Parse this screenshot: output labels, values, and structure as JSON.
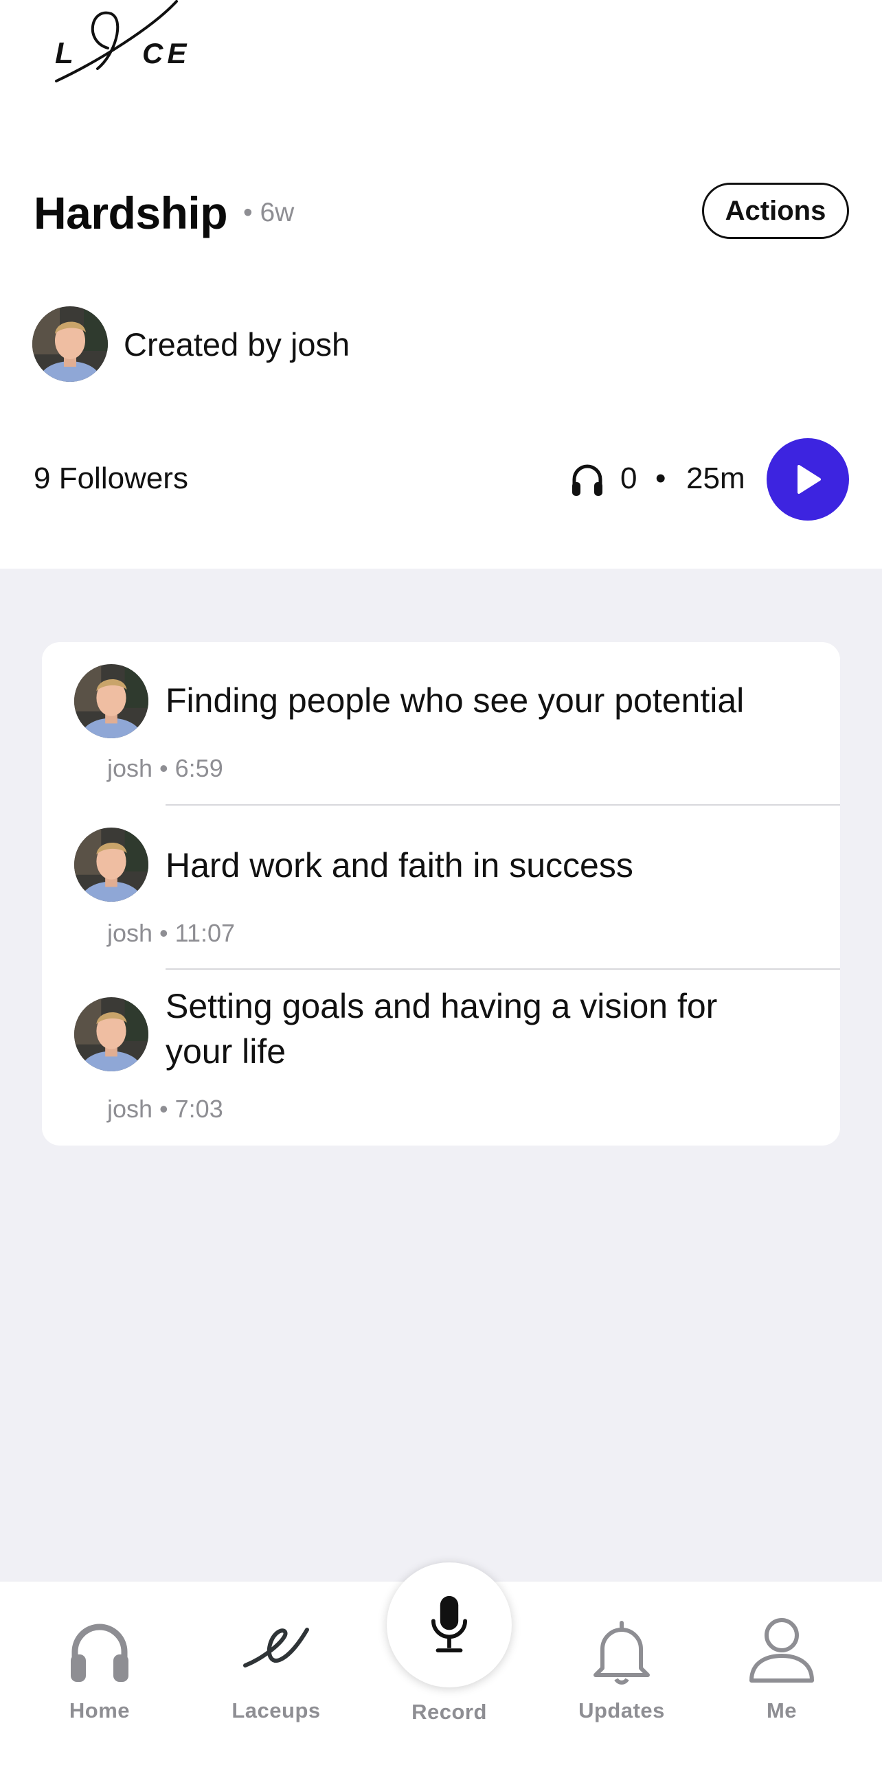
{
  "logo": {
    "text": "LACE"
  },
  "header": {
    "title": "Hardship",
    "age": "• 6w",
    "actions_label": "Actions"
  },
  "creator": {
    "text": "Created by josh"
  },
  "stats": {
    "followers": "9 Followers",
    "listens": "0",
    "separator": "•",
    "duration": "25m"
  },
  "episodes": [
    {
      "title": "Finding people who see your potential",
      "meta": "josh • 6:59"
    },
    {
      "title": "Hard work and faith in success",
      "meta": "josh • 11:07"
    },
    {
      "title": "Setting goals and having a vision for your life",
      "meta": "josh • 7:03"
    }
  ],
  "tabbar": {
    "home": "Home",
    "laceups": "Laceups",
    "record": "Record",
    "updates": "Updates",
    "me": "Me"
  },
  "colors": {
    "accent": "#3d24e0",
    "background": "#f0f0f5",
    "muted": "#8e8e93"
  }
}
